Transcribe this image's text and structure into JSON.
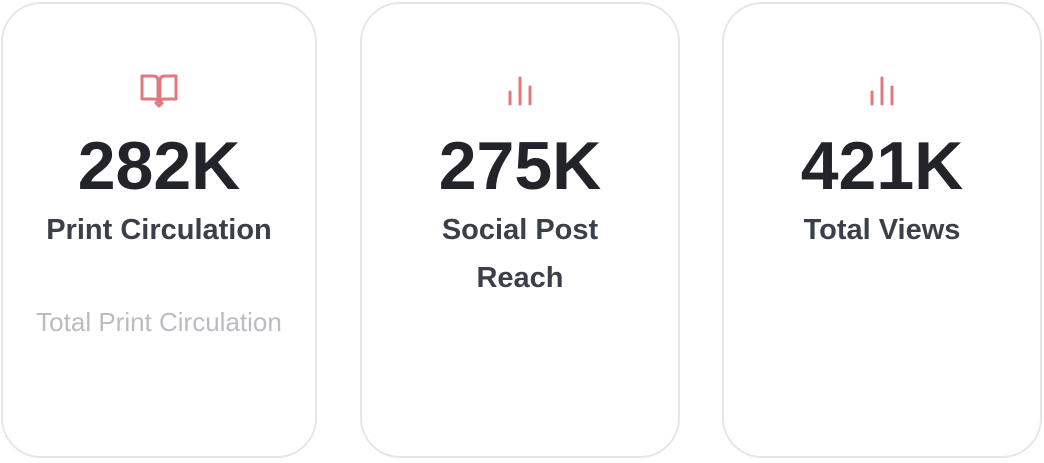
{
  "accent_color": "#e0787c",
  "cards": [
    {
      "icon": "book-open-icon",
      "value": "282K",
      "label": "Print Circulation",
      "description": "Total Print Circulation"
    },
    {
      "icon": "bar-chart-icon",
      "value": "275K",
      "label": "Social Post Reach"
    },
    {
      "icon": "bar-chart-icon",
      "value": "421K",
      "label": "Total Views"
    }
  ]
}
